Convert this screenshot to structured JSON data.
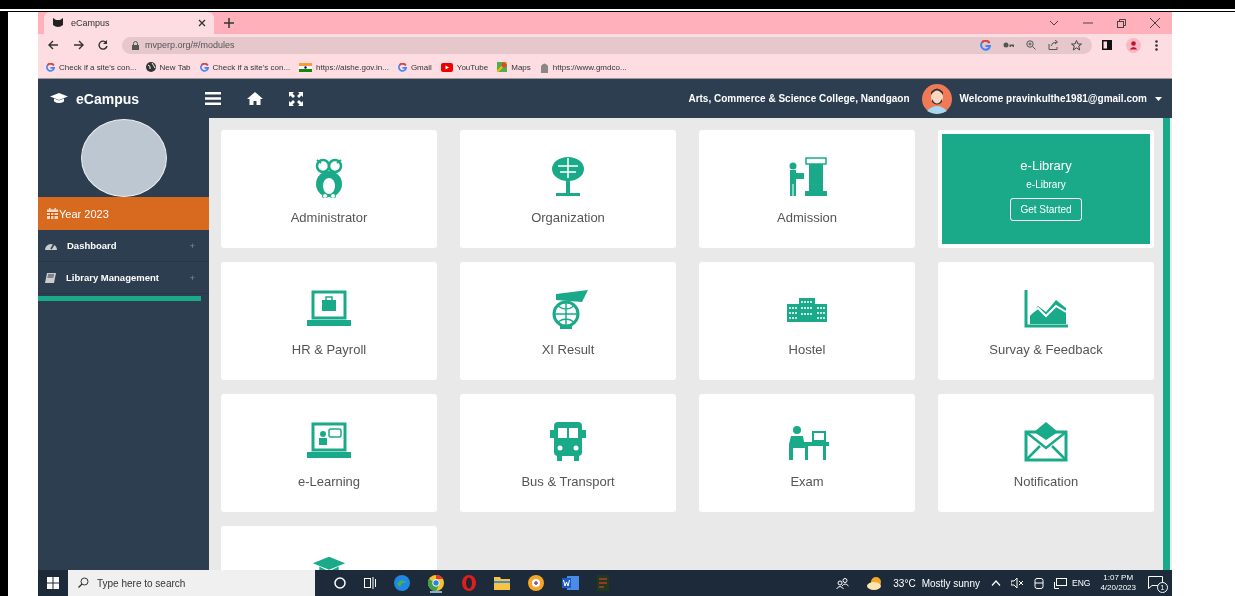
{
  "browser": {
    "tab_title": "eCampus",
    "url": "mvperp.org/#/modules",
    "bookmarks": [
      {
        "label": "Check if a site's con...",
        "kind": "google"
      },
      {
        "label": "New Tab",
        "kind": "globe"
      },
      {
        "label": "Check if a site's con...",
        "kind": "google"
      },
      {
        "label": "https://aishe.gov.in...",
        "kind": "flag"
      },
      {
        "label": "Gmail",
        "kind": "google"
      },
      {
        "label": "YouTube",
        "kind": "youtube"
      },
      {
        "label": "Maps",
        "kind": "maps"
      },
      {
        "label": "https://www.gmdco...",
        "kind": "seal"
      }
    ]
  },
  "header": {
    "brand": "eCampus",
    "college": "Arts, Commerce & Science College, Nandgaon",
    "welcome": "Welcome pravinkulthe1981@gmail.com"
  },
  "sidebar": {
    "year": "Year 2023",
    "items": [
      {
        "label": "Dashboard",
        "expand": "+"
      },
      {
        "label": "Library Management",
        "expand": "+"
      }
    ]
  },
  "modules": [
    {
      "kind": "tile",
      "label": "Administrator"
    },
    {
      "kind": "tile",
      "label": "Organization"
    },
    {
      "kind": "tile",
      "label": "Admission"
    },
    {
      "kind": "featured",
      "label": "e-Library",
      "subtitle": "e-Library",
      "button": "Get Started"
    },
    {
      "kind": "tile",
      "label": "HR & Payroll"
    },
    {
      "kind": "tile",
      "label": "XI Result"
    },
    {
      "kind": "tile",
      "label": "Hostel"
    },
    {
      "kind": "tile",
      "label": "Survay & Feedback"
    },
    {
      "kind": "tile",
      "label": "e-Learning"
    },
    {
      "kind": "tile",
      "label": "Bus & Transport"
    },
    {
      "kind": "tile",
      "label": "Exam"
    },
    {
      "kind": "tile",
      "label": "Notification"
    },
    {
      "kind": "partial"
    }
  ],
  "taskbar": {
    "search_placeholder": "Type here to search",
    "temperature": "33°C",
    "weather": "Mostly sunny",
    "language": "ENG",
    "time": "1:07 PM",
    "date": "4/20/2023",
    "notifications": "1"
  }
}
